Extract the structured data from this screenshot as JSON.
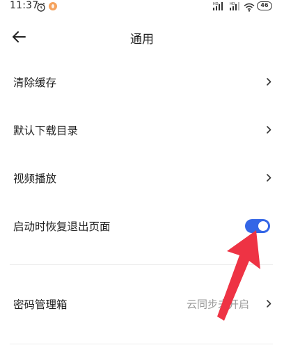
{
  "status_bar": {
    "time": "11:37",
    "battery_level": "46",
    "icons": [
      "alarm-icon",
      "notification-badge",
      "signal-hd-icon",
      "signal-hd-icon",
      "wifi-icon",
      "battery-icon"
    ]
  },
  "nav": {
    "title": "通用",
    "back_icon": "arrow-left-icon"
  },
  "settings": [
    {
      "label": "清除缓存",
      "control": "chevron"
    },
    {
      "label": "默认下载目录",
      "control": "chevron"
    },
    {
      "label": "视频播放",
      "control": "chevron"
    },
    {
      "label": "启动时恢复退出页面",
      "control": "toggle",
      "toggle_on": true
    },
    {
      "label": "密码管理箱",
      "value": "云同步未开启",
      "control": "chevron"
    }
  ],
  "colors": {
    "toggle_on": "#3466e6",
    "annotation_arrow": "#ee3344",
    "value_text": "#9a9a9a",
    "divider": "#ececec"
  }
}
